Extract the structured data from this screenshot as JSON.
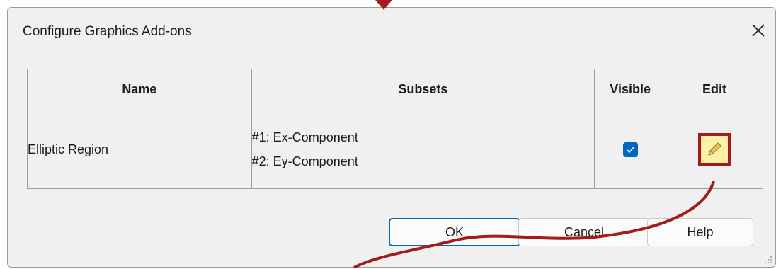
{
  "dialog": {
    "title": "Configure Graphics Add-ons",
    "close_icon": "close-icon"
  },
  "table": {
    "columns": [
      "Name",
      "Subsets",
      "Visible",
      "Edit"
    ],
    "rows": [
      {
        "name": "Elliptic Region",
        "subsets": [
          "#1: Ex-Component",
          "#2: Ey-Component"
        ],
        "visible": true,
        "edit_icon": "pencil-icon"
      }
    ]
  },
  "buttons": {
    "ok": "OK",
    "cancel": "Cancel",
    "help": "Help"
  },
  "colors": {
    "accent": "#0067c0",
    "annotation": "#a31c1c",
    "edit_highlight": "#fff0a8"
  }
}
